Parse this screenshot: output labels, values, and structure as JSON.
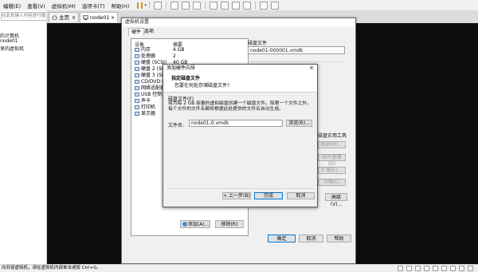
{
  "menubar": {
    "items": [
      "编辑(E)",
      "查看(V)",
      "虚拟机(M)",
      "选项卡(T)",
      "帮助(H)"
    ]
  },
  "library": {
    "search_placeholder": "在此处键入内容进行搜...",
    "items": [
      "的计算机",
      "node01",
      "享的虚拟机"
    ]
  },
  "tabs": [
    {
      "label": "主页",
      "close": "×"
    },
    {
      "label": "node01",
      "close": "×"
    }
  ],
  "vm_settings": {
    "title": "虚拟机设置",
    "tabs": [
      "硬件",
      "选项"
    ],
    "device_header": "设备",
    "summary_header": "摘要",
    "devices": [
      {
        "name": "内存",
        "summary": "4 GB"
      },
      {
        "name": "处理器",
        "summary": "2"
      },
      {
        "name": "硬盘 (SCSI)",
        "summary": "40 GB"
      },
      {
        "name": "硬盘 2 (SCSI)",
        "summary": ""
      },
      {
        "name": "硬盘 3 (SCSI)",
        "summary": ""
      },
      {
        "name": "CD/DVD (IDE)",
        "summary": ""
      },
      {
        "name": "网络适配器",
        "summary": ""
      },
      {
        "name": "USB 控制器",
        "summary": ""
      },
      {
        "name": "声卡",
        "summary": ""
      },
      {
        "name": "打印机",
        "summary": ""
      },
      {
        "name": "显示器",
        "summary": ""
      }
    ],
    "disk_file_label": "磁盘文件",
    "disk_file_value": "node01-000001.vmdk",
    "disk_util_label": "磁盘实用工具",
    "util_buttons": [
      "映射(M)...",
      "碎片整理(D)",
      "扩展(E)...",
      "压缩(C)"
    ],
    "advanced_label": "高级(V)...",
    "add_label": "添加(A)...",
    "remove_label": "移除(R)",
    "ok_label": "确定",
    "cancel_label": "取消",
    "help_label": "帮助"
  },
  "wizard": {
    "title": "添加硬件向导",
    "heading": "指定磁盘文件",
    "subheading": "您要在何处存储磁盘文件?",
    "group_label": "磁盘文件(F)",
    "description": "将为每 2 GB 容量的虚拟磁盘创建一个磁盘文件。除第一个文件之外，每个文件的文件名都将根据此处提供的文件名自动生成。",
    "file_label": "文件名:",
    "file_value": "node01-0.vmdk",
    "browse_label": "浏览(R)...",
    "back_label": "< 上一步(B)",
    "finish_label": "完成",
    "cancel_label": "取消",
    "close": "×"
  },
  "statusbar": {
    "text": "向到该虚拟机，请在虚拟机内部单击或按 Ctrl+G。"
  },
  "colors": {
    "accent": "#0078d7",
    "selection": "#cce4f7",
    "desktop": "#0d0d0d",
    "pause": "#e08d14"
  }
}
